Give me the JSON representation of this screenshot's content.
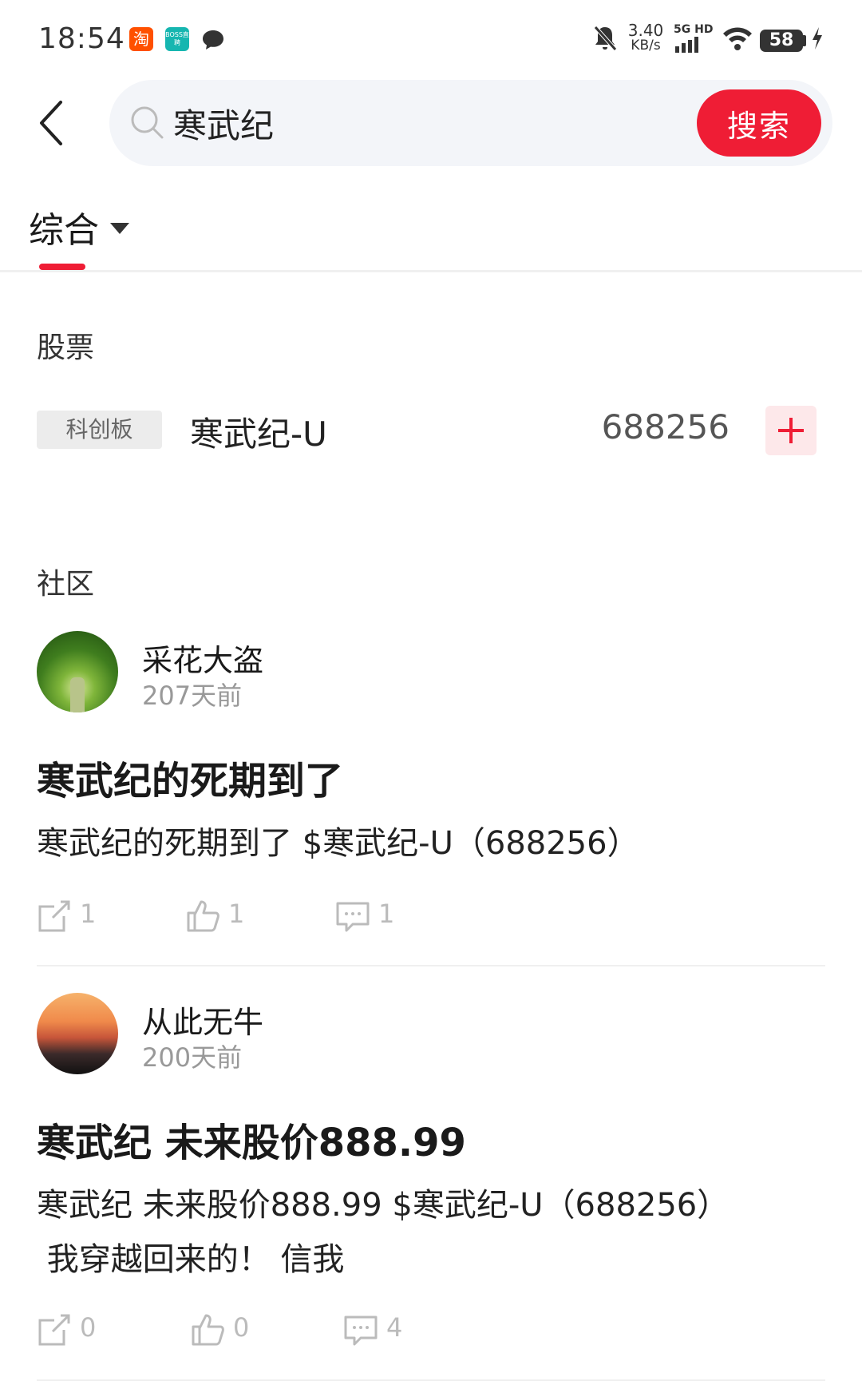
{
  "status_bar": {
    "time": "18:54",
    "taobao_glyph": "淘",
    "boss_label": "BOSS直聘",
    "net_speed_value": "3.40",
    "net_speed_unit": "KB/s",
    "network_label": "5G HD",
    "battery_level": "58"
  },
  "search": {
    "query": "寒武纪",
    "button_label": "搜索"
  },
  "filter": {
    "tab_label": "综合"
  },
  "stocks": {
    "section_title": "股票",
    "items": [
      {
        "market": "科创板",
        "name": "寒武纪-U",
        "code": "688256"
      }
    ]
  },
  "community": {
    "section_title": "社区",
    "posts": [
      {
        "author": "采花大盗",
        "time": "207天前",
        "title": "寒武纪的死期到了",
        "body_line1": "寒武纪的死期到了 $寒武纪-U（688256）",
        "body_line2": "",
        "shares": "1",
        "likes": "1",
        "comments": "1"
      },
      {
        "author": "从此无牛",
        "time": "200天前",
        "title": "寒武纪 未来股价888.99",
        "body_line1": "寒武纪 未来股价888.99 $寒武纪-U（688256）",
        "body_line2": " 我穿越回来的！ 信我",
        "shares": "0",
        "likes": "0",
        "comments": "4"
      }
    ]
  },
  "icons": {
    "back": "chevron-left-icon",
    "search": "search-icon",
    "dropdown": "triangle-down-icon",
    "add": "plus-icon",
    "share": "share-icon",
    "like": "thumbs-up-icon",
    "comment": "comment-icon"
  },
  "colors": {
    "accent": "#ef1d35",
    "search_bg": "#f3f5f9",
    "badge_bg": "#ececec",
    "add_bg": "#fde8ea",
    "muted_text": "#999999"
  }
}
